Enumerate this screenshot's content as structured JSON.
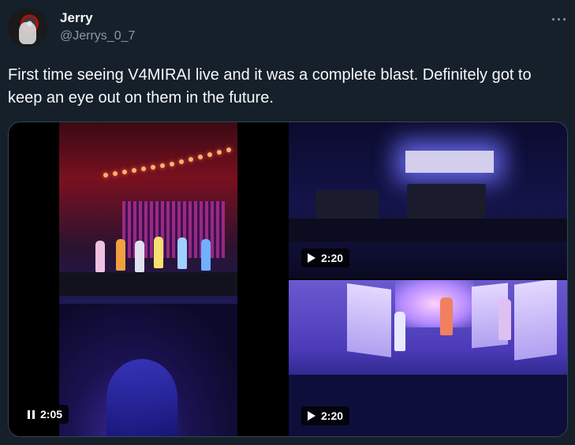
{
  "author": {
    "name": "Jerry",
    "handle": "@Jerrys_0_7"
  },
  "tweet": {
    "text": "First time seeing V4MIRAI live and it was a complete blast. Definitely got to keep an eye out on them in the future."
  },
  "media": [
    {
      "icon": "pause-icon",
      "duration": "2:05",
      "state": "playing"
    },
    {
      "icon": "play-icon",
      "duration": "2:20",
      "state": "paused"
    },
    {
      "icon": "play-icon",
      "duration": "2:20",
      "state": "paused"
    }
  ],
  "colors": {
    "background": "#15202b",
    "text": "#f7f9f9",
    "secondary": "#8b98a5",
    "border": "#38444d"
  }
}
